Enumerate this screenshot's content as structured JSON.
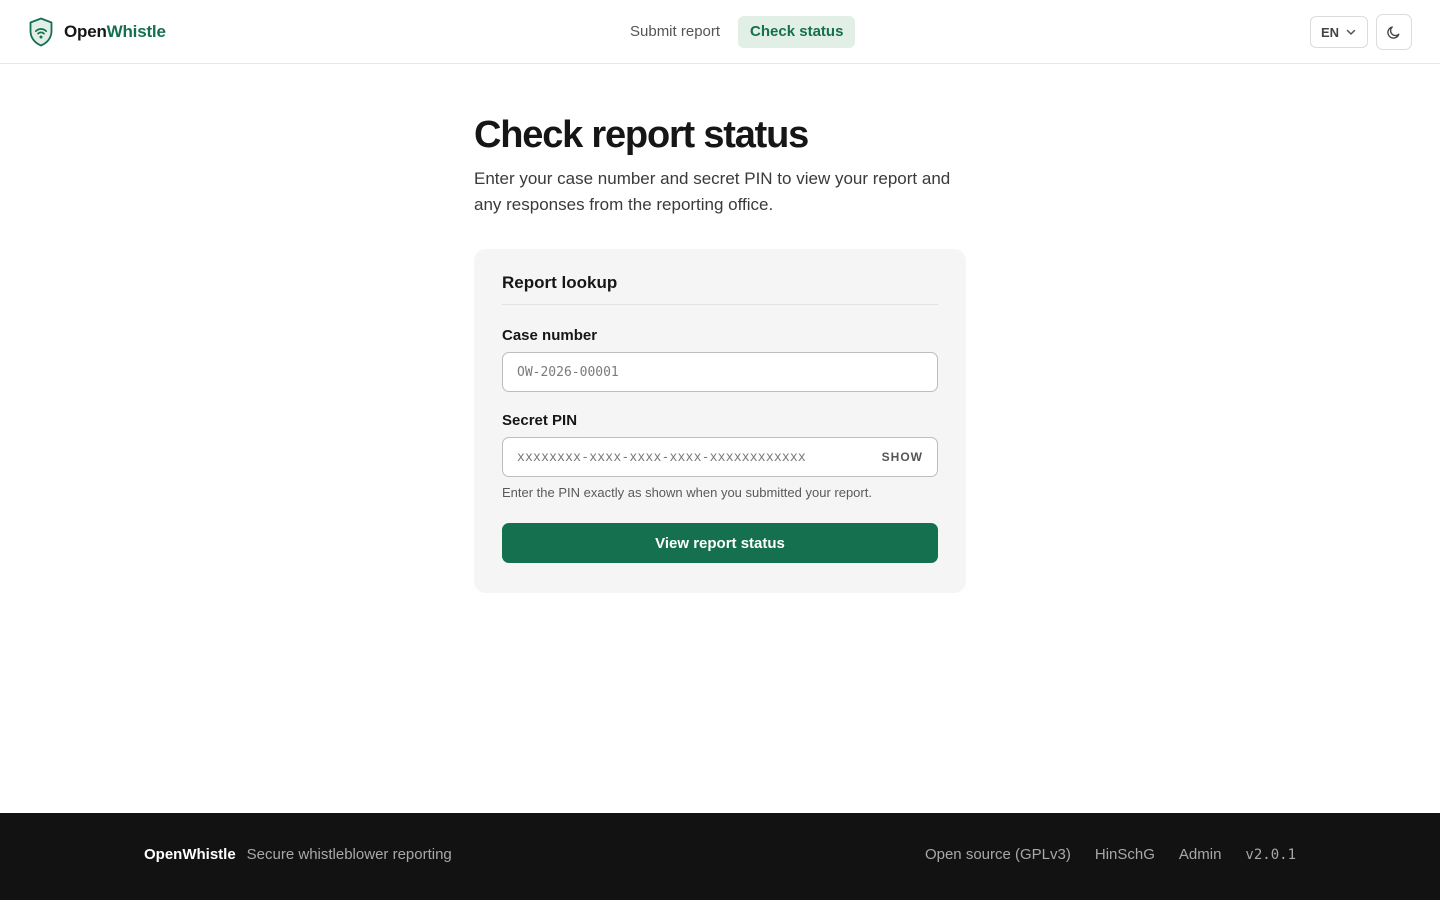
{
  "header": {
    "brand_part1": "Open",
    "brand_part2": "Whistle",
    "logo_icon": "shield-wifi-icon",
    "nav": [
      {
        "label": "Submit report",
        "active": false
      },
      {
        "label": "Check status",
        "active": true
      }
    ],
    "language": "EN",
    "theme_icon": "moon-icon"
  },
  "main": {
    "title": "Check report status",
    "subtitle": "Enter your case number and secret PIN to view your report and any responses from the reporting office.",
    "card": {
      "title": "Report lookup",
      "case_label": "Case number",
      "case_placeholder": "OW-2026-00001",
      "pin_label": "Secret PIN",
      "pin_placeholder": "xxxxxxxx-xxxx-xxxx-xxxx-xxxxxxxxxxxx",
      "show_label": "SHOW",
      "hint": "Enter the PIN exactly as shown when you submitted your report.",
      "submit_label": "View report status"
    }
  },
  "footer": {
    "brand": "OpenWhistle",
    "tagline": "Secure whistleblower reporting",
    "links": [
      "Open source (GPLv3)",
      "HinSchG",
      "Admin"
    ],
    "version": "v2.0.1"
  },
  "colors": {
    "accent": "#14704f",
    "accent_light": "#e1efe7",
    "card_bg": "#f5f5f5",
    "footer_bg": "#121212"
  }
}
